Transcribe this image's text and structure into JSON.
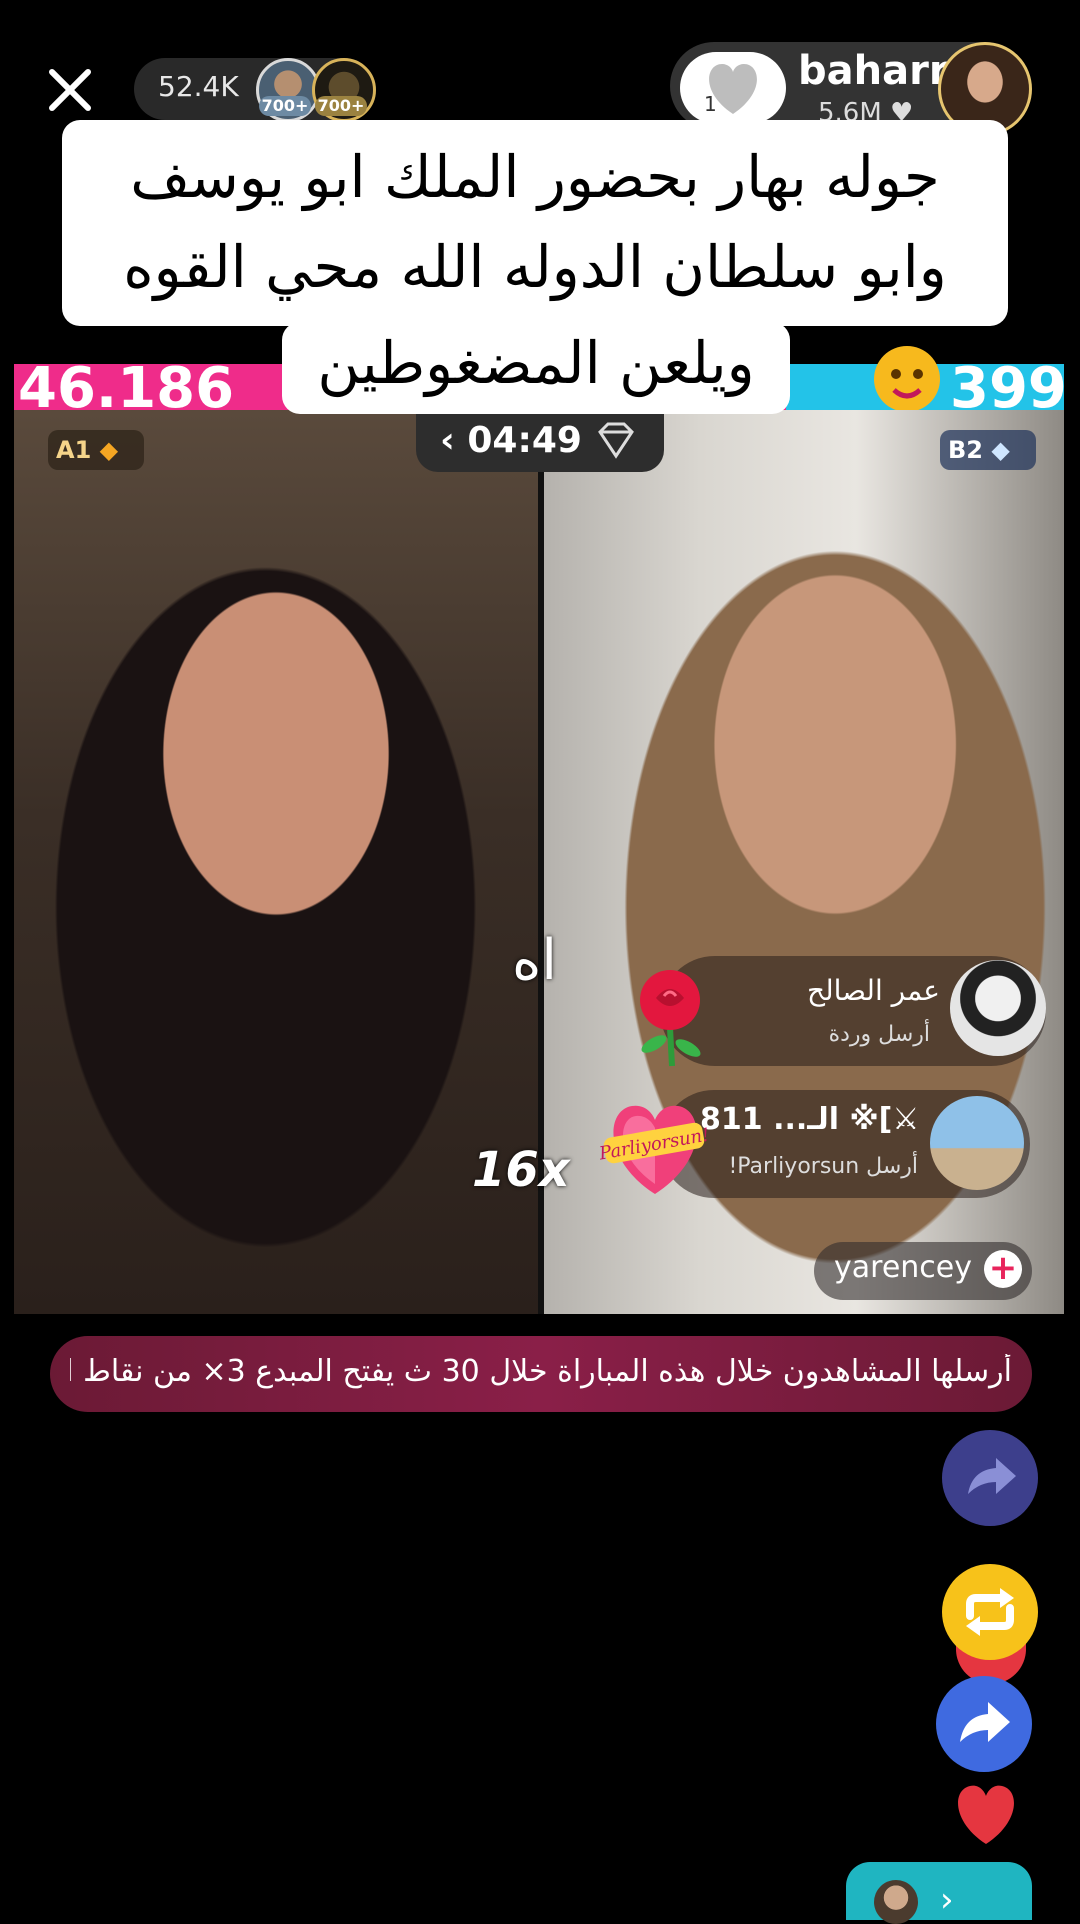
{
  "top_bar": {
    "viewer_count": "52.4K",
    "viewer_badges": [
      "700+",
      "700+"
    ],
    "host": {
      "name": "baharr",
      "likes": "5.6M",
      "like_button_count": "1"
    }
  },
  "caption": {
    "lines": [
      "جوله بهار بحضور الملك ابو يوسف",
      "وابو سلطان الدوله الله محي القوه",
      "ويلعن المضغوطين"
    ]
  },
  "battle": {
    "left_score": "46.186",
    "right_score": "399",
    "timer": "04:49",
    "team_a": "A1",
    "team_b": "B2",
    "colors": {
      "left": "#ef2c8a",
      "right": "#23c3e8"
    }
  },
  "overlay": {
    "sound_text": "اه",
    "combo": "16x"
  },
  "gifts": [
    {
      "name": "عمر الصالح",
      "action": "أرسل وردة",
      "icon": "rose-icon"
    },
    {
      "name": "الـ... 811 ※[⚔",
      "action": "أرسل Parliyorsun!",
      "icon": "parliyorsun-heart-icon"
    }
  ],
  "follow": {
    "name": "yarencey",
    "plus": "+"
  },
  "banner": {
    "text": "أرسلها المشاهدون خلال هذه المباراة خلال 30 ث    يفتح المبدع 3× من نقاط ا"
  },
  "side_actions": [
    "share-icon",
    "repost-icon",
    "forward-icon",
    "heart-icon"
  ]
}
